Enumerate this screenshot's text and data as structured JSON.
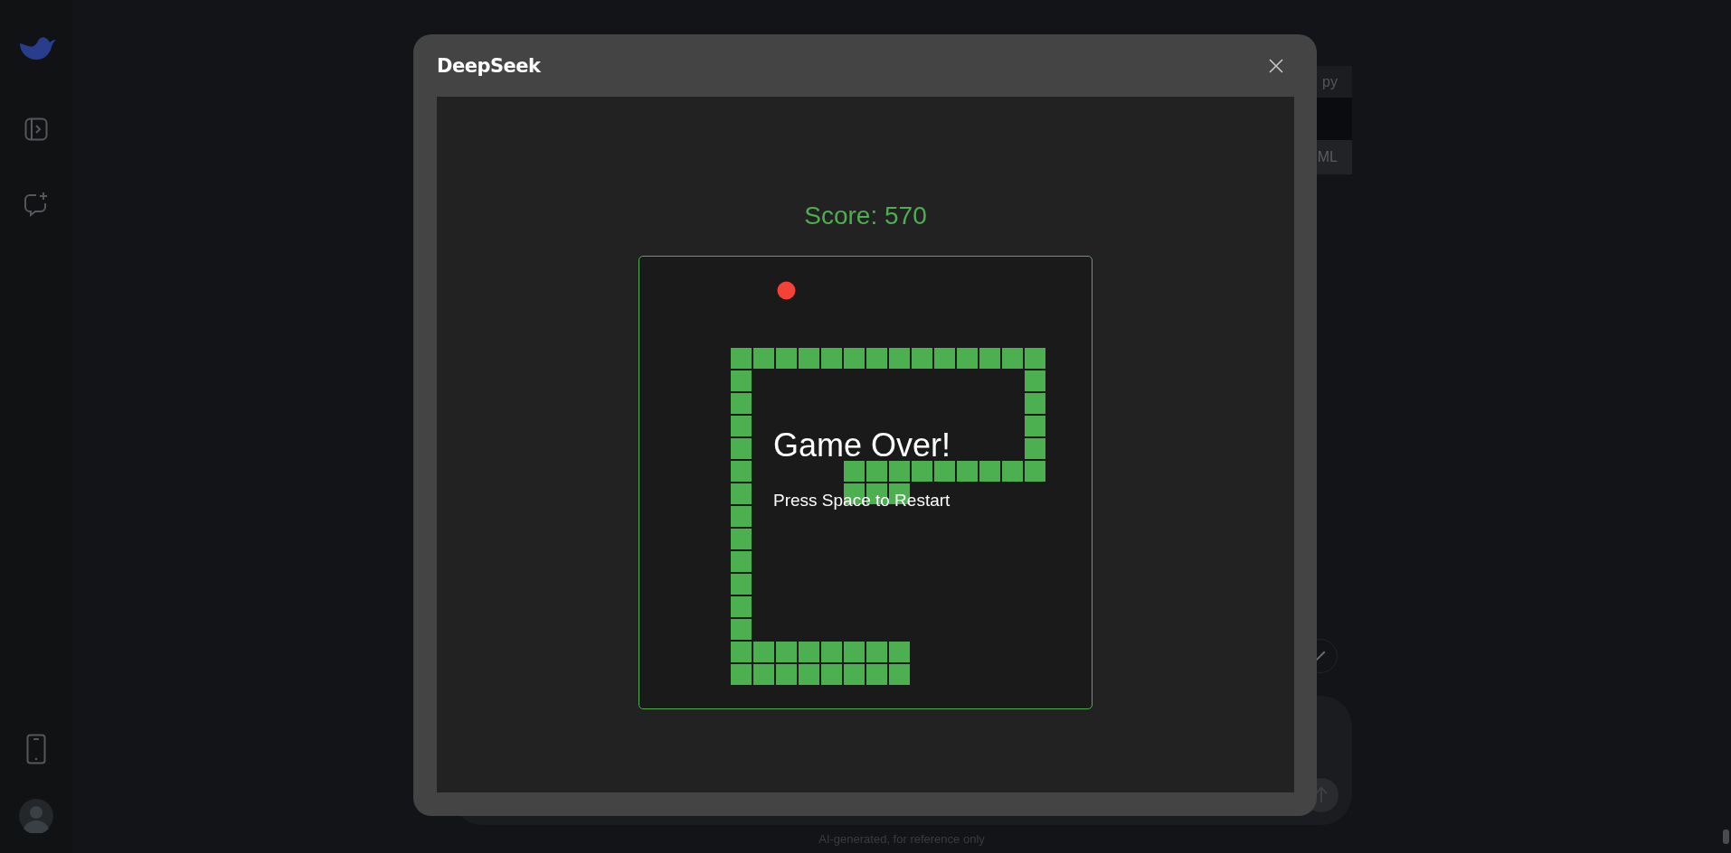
{
  "background": {
    "code_header_button": "py",
    "code_footer_button": "ML",
    "disclaimer": "AI-generated, for reference only"
  },
  "dialog": {
    "title": "DeepSeek",
    "score": "Score: 570",
    "game_over": {
      "title": "Game Over!",
      "hint": "Press Space to Restart"
    }
  }
}
